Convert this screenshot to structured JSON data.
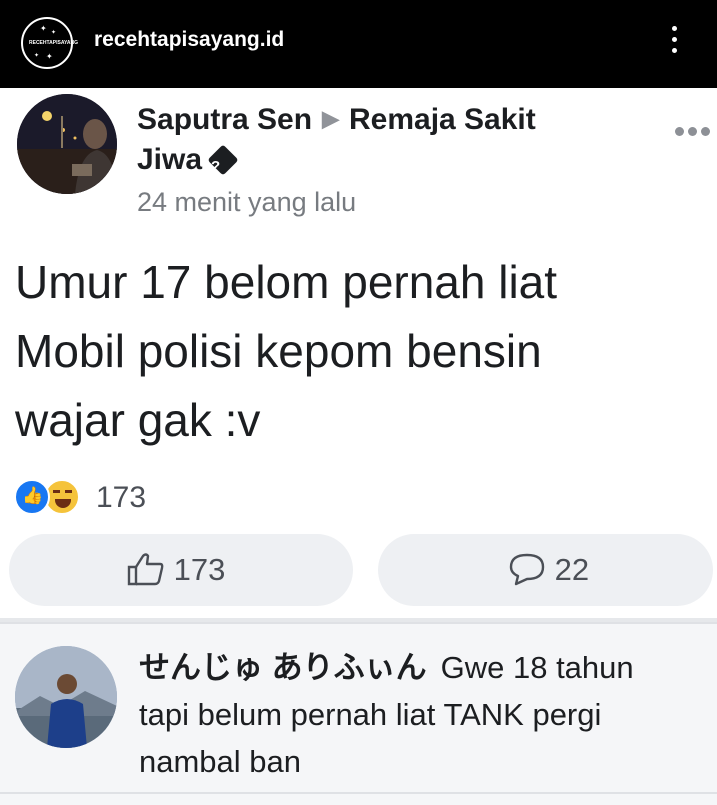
{
  "instagram": {
    "username": "recehtapisayang.id",
    "logo_text": "RECEHTAPISAYANG"
  },
  "post": {
    "author": "Saputra Sen",
    "group": "Remaja Sakit",
    "group_cont": "Jiwa",
    "timestamp": "24 menit yang lalu",
    "text_lines": [
      "Umur 17 belom pernah liat",
      "Mobil polisi kepom bensin",
      "wajar gak :v"
    ],
    "reaction_count": "173",
    "like_count": "173",
    "comment_count": "22"
  },
  "comment": {
    "author": "せんじゅ ありふぃん",
    "text_first": "Gwe 18 tahun",
    "text_line2": "tapi belum pernah liat TANK pergi",
    "text_line3": "nambal ban"
  },
  "colors": {
    "facebook_blue": "#1877f2",
    "haha_yellow": "#f5c33b",
    "button_gray": "#eef0f3",
    "text_dark": "#1c1e21",
    "text_muted": "#777b80"
  }
}
